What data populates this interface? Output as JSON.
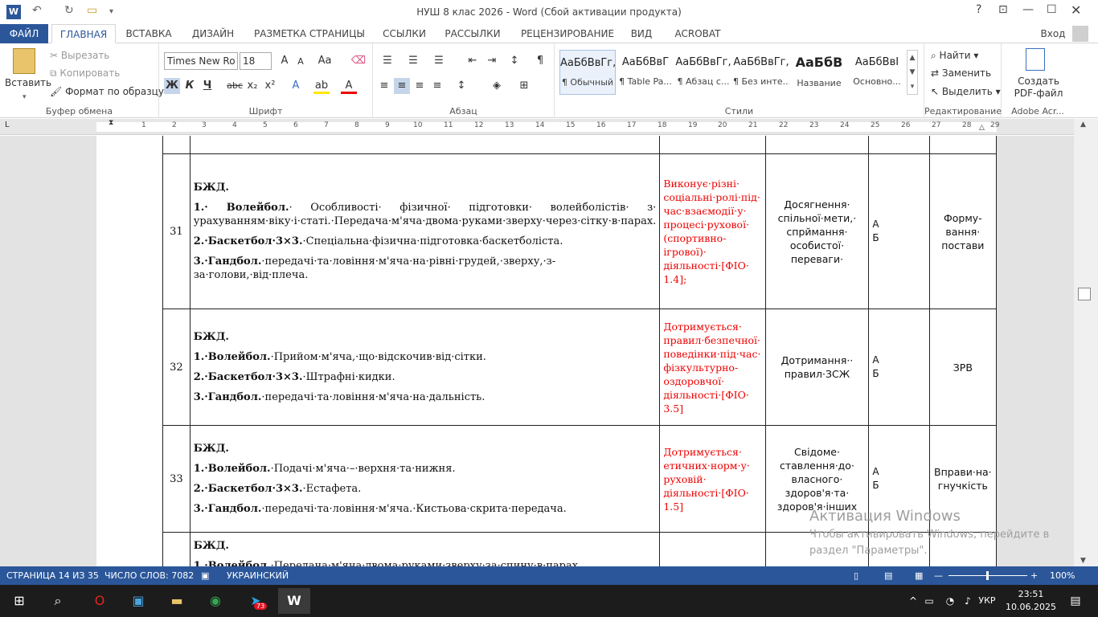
{
  "title": "НУШ 8 клас 2026 - Word (Сбой активации продукта)",
  "ribbon_tabs": [
    "ФАЙЛ",
    "ГЛАВНАЯ",
    "ВСТАВКА",
    "ДИЗАЙН",
    "РАЗМЕТКА СТРАНИЦЫ",
    "ССЫЛКИ",
    "РАССЫЛКИ",
    "РЕЦЕНЗИРОВАНИЕ",
    "ВИД",
    "ACROBAT"
  ],
  "signin": "Вход",
  "clipboard": {
    "paste": "Вставить",
    "cut": "Вырезать",
    "copy": "Копировать",
    "format": "Формат по образцу",
    "label": "Буфер обмена"
  },
  "font": {
    "name": "Times New Ro",
    "size": "18",
    "label": "Шрифт",
    "bold": "Ж",
    "italic": "К",
    "underline": "Ч"
  },
  "paragraph": {
    "label": "Абзац"
  },
  "styles": {
    "items": [
      {
        "pv": "АаБбВвГг,",
        "nm": "¶ Обычный"
      },
      {
        "pv": "АаБбВвГ",
        "nm": "¶ Table Pa..."
      },
      {
        "pv": "АаБбВвГг,",
        "nm": "¶ Абзац с..."
      },
      {
        "pv": "АаБбВвГг,",
        "nm": "¶ Без инте..."
      },
      {
        "pv": "АаБбВ",
        "nm": "Название"
      },
      {
        "pv": "АаБбВвI",
        "nm": "Основно..."
      }
    ],
    "label": "Стили"
  },
  "editing": {
    "find": "Найти",
    "replace": "Заменить",
    "select": "Выделить",
    "label": "Редактирование"
  },
  "acrobat": {
    "create": "Создать PDF-файл",
    "label": "Adobe Acr..."
  },
  "ruler_numbers": [
    "1",
    "2",
    "3",
    "4",
    "5",
    "6",
    "7",
    "8",
    "9",
    "10",
    "11",
    "12",
    "13",
    "14",
    "15",
    "16",
    "17",
    "18",
    "19",
    "20",
    "21",
    "22",
    "23",
    "24",
    "25",
    "26",
    "27",
    "28",
    "29"
  ],
  "rows": [
    {
      "num": "31",
      "content": [
        {
          "b": "БЖД.",
          "t": ""
        },
        {
          "b": "1.· Волейбол.",
          "t": "· Особливості· фізичної· підготовки· волейболістів· з· урахуванням·віку·і·статі.·Передача·м'яча·двома·руками·зверху·через·сітку·в·парах."
        },
        {
          "b": "2.·Баскетбол·3×3.",
          "t": "·Спеціальна·фізична·підготовка·баскетболіста."
        },
        {
          "b": "3.·Гандбол.",
          "t": "·передачі·та·ловіння·м'яча·на·рівні·грудей,·зверху,·з-за·голови,·від·плеча."
        }
      ],
      "result": "Виконує·різні· соціальні·ролі·під· час·взаємодії·у· процесі·рухової· (спортивно- ігрової)· діяльності·[ФІО· 1.4];",
      "meta": "Досягнення· спільної·мети,· спрймання· особистої· переваги·",
      "level1": "А",
      "level2": "Б",
      "extra": "Форму- вання· постави"
    },
    {
      "num": "32",
      "content": [
        {
          "b": "БЖД.",
          "t": ""
        },
        {
          "b": "1.·Волейбол.",
          "t": "·Прийом·м'яча,·що·відскочив·від·сітки."
        },
        {
          "b": "2.·Баскетбол·3×3.",
          "t": "·Штрафні·кидки."
        },
        {
          "b": "3.·Гандбол.",
          "t": "·передачі·та·ловіння·м'яча·на·дальність."
        }
      ],
      "result": "Дотримується· правил·безпечної· поведінки·під·час· фізкультурно- оздоровчої· діяльності·[ФІО· 3.5]",
      "meta": "Дотримання·· правил·ЗСЖ",
      "level1": "А",
      "level2": "Б",
      "extra": "ЗРВ"
    },
    {
      "num": "33",
      "content": [
        {
          "b": "БЖД.",
          "t": ""
        },
        {
          "b": "1.·Волейбол.",
          "t": "·Подачі·м'яча·–·верхня·та·нижня."
        },
        {
          "b": "2.·Баскетбол·3×3.",
          "t": "·Естафета."
        },
        {
          "b": "3.·Гандбол.",
          "t": "·передачі·та·ловіння·м'яча.·Кистьова·скрита·передача."
        }
      ],
      "result": "Дотримується· етичних·норм·у· руховій· діяльності·[ФІО· 1.5]",
      "meta": "Свідоме· ставлення·до· власного· здоров'я·та· здоров'я·інших",
      "level1": "А",
      "level2": "Б",
      "extra": "Вправи·на· гнучкість"
    },
    {
      "num": "",
      "content": [
        {
          "b": "БЖД.",
          "t": ""
        },
        {
          "b": "1.·Волейбол.",
          "t": "·Передача·м'яча·двома·руками·зверху·за·спину·в·парах."
        }
      ],
      "result": "",
      "meta": "",
      "level1": "",
      "level2": "",
      "extra": ""
    }
  ],
  "watermark": {
    "title": "Активация Windows",
    "line1": "Чтобы активировать Windows, перейдите в",
    "line2": "раздел \"Параметры\"."
  },
  "status": {
    "page": "СТРАНИЦА 14 ИЗ 35",
    "words": "ЧИСЛО СЛОВ: 7082",
    "lang": "УКРАИНСКИЙ",
    "zoom": "100%"
  },
  "taskbar": {
    "lang": "УКР",
    "time": "23:51",
    "date": "10.06.2025",
    "telegram_badge": "73"
  }
}
